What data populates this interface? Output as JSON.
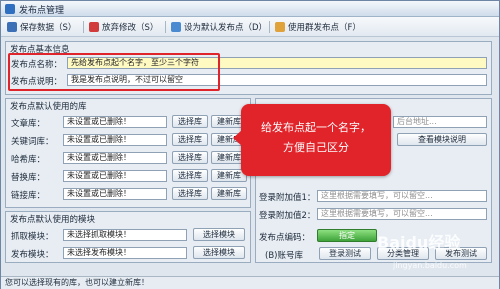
{
  "window": {
    "title": "发布点管理"
  },
  "toolbar": {
    "save": "保存数据（S）",
    "discard": "放弃修改（S）",
    "set_default": "设为默认发布点（D）",
    "use": "使用群发布点（F）"
  },
  "basic": {
    "title": "发布点基本信息",
    "name_label": "发布点名称：",
    "name_value": "先给发布点起个名字，至少三个字符",
    "desc_label": "发布点说明：",
    "desc_value": "我是发布点说明，不过可以留空"
  },
  "libs": {
    "title": "发布点默认使用的库",
    "rows": [
      {
        "label": "文章库：",
        "value": "未设置或已删除！",
        "choose": "选择库",
        "new": "建新库"
      },
      {
        "label": "关键词库：",
        "value": "未设置或已删除！",
        "choose": "选择库",
        "new": "建新库"
      },
      {
        "label": "哈希库：",
        "value": "未设置或已删除！",
        "choose": "选择库",
        "new": "建新库"
      },
      {
        "label": "替换库：",
        "value": "未设置或已删除！",
        "choose": "选择库",
        "new": "建新库"
      },
      {
        "label": "链接库：",
        "value": "未设置或已删除！",
        "choose": "选择库",
        "new": "建新库"
      }
    ]
  },
  "modules": {
    "title": "发布点默认使用的模块",
    "rows": [
      {
        "label": "抓取模块：",
        "value": "未选择抓取模块！",
        "choose": "选择模块"
      },
      {
        "label": "发布模块：",
        "value": "未选择发布模块！",
        "choose": "选择模块"
      }
    ]
  },
  "right": {
    "backend_placeholder": "后台地址...",
    "view_help": "查看模块说明",
    "login_extra1_label": "登录附加值1：",
    "login_extra1_placeholder": "这里根据需要填写，可以留空...",
    "login_extra2_label": "登录附加值2：",
    "login_extra2_placeholder": "这里根据需要填写，可以留空...",
    "encoding_label": "发布点编码：",
    "encoding_value": "指定",
    "account_label": "(B)账号库",
    "login_test": "登录测试",
    "category_manage": "分类管理",
    "publish_test": "发布测试"
  },
  "callout": {
    "line1": "给发布点起一个名字，",
    "line2": "方便自己区分"
  },
  "status": {
    "text": "您可以选择现有的库，也可以建立新库！"
  },
  "watermark": {
    "brand": "Baidu经验",
    "url": "jingyan.baidu.com"
  },
  "colors": {
    "highlight_red": "#e0242b",
    "callout_red": "#e1232a",
    "name_field": "#fff9c2",
    "green_button": "#3ea33a"
  }
}
